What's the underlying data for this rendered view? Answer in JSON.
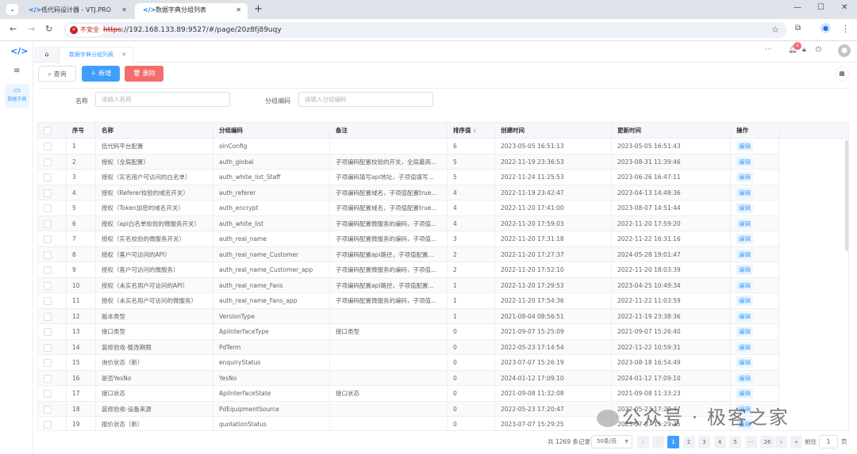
{
  "browser": {
    "tabs": [
      {
        "title": "低代码设计器 - VTJ.PRO",
        "active": false
      },
      {
        "title": "数据字典分组列表",
        "active": true
      }
    ],
    "insecure_label": "不安全",
    "url_scheme": "https",
    "url_rest": "://192.168.133.89:9527/#/page/20z8fj89uqy"
  },
  "sidebar": {
    "logo": "</>",
    "items": [
      {
        "label": "数据字典",
        "icon": "monitor-icon"
      }
    ]
  },
  "page_tabs": {
    "active": "数据字典分组列表"
  },
  "header": {
    "notification_count": "1"
  },
  "toolbar": {
    "query": "查询",
    "add": "新增",
    "delete": "删除"
  },
  "filters": [
    {
      "label": "名称",
      "placeholder": "请输入名称"
    },
    {
      "label": "分组编码",
      "placeholder": "请输入分组编码"
    }
  ],
  "table": {
    "columns": [
      "序号",
      "名称",
      "分组编码",
      "备注",
      "排序值",
      "创建时间",
      "更新时间",
      "操作"
    ],
    "action_label": "编辑",
    "rows": [
      [
        "1",
        "低代码平台配置",
        "oinConfig",
        "",
        "6",
        "2023-05-05 16:51:13",
        "2023-05-05 16:51:43"
      ],
      [
        "2",
        "授权（全局配置）",
        "auth_global",
        "子项编码配置校验的开关，全局最高...",
        "5",
        "2022-11-19 23:36:53",
        "2023-08-31 11:39:46"
      ],
      [
        "3",
        "授权（实名用户可访问的白名单）",
        "auth_white_list_Staff",
        "子项编码填写api地址，子项值填写...",
        "5",
        "2022-11-24 11:25:53",
        "2023-06-26 16:47:11"
      ],
      [
        "4",
        "授权（Referer校验的域名开关）",
        "auth_referer",
        "子项编码配置域名，子项值配置true...",
        "4",
        "2022-11-19 23:42:47",
        "2023-04-13 14:48:36"
      ],
      [
        "5",
        "授权（Token加密的域名开关）",
        "auth_encrypt",
        "子项编码配置域名，子项值配置true...",
        "4",
        "2022-11-20 17:41:00",
        "2023-08-07 14:51:44"
      ],
      [
        "6",
        "授权（api白名单校验的微服务开关）",
        "auth_white_list",
        "子项编码配置微服务的编码，子项值...",
        "4",
        "2022-11-20 17:59:03",
        "2022-11-20 17:59:20"
      ],
      [
        "7",
        "授权（实名校验的微服务开关）",
        "auth_real_name",
        "子项编码配置微服务的编码，子项值...",
        "3",
        "2022-11-20 17:31:18",
        "2022-11-22 16:31:16"
      ],
      [
        "8",
        "授权（客户可访问的API）",
        "auth_real_name_Customer",
        "子项编码配置api路径，子项值配置...",
        "2",
        "2022-11-20 17:27:37",
        "2024-05-28 19:01:47"
      ],
      [
        "9",
        "授权（客户可访问的微服务）",
        "auth_real_name_Customer_app",
        "子项编码配置微服务的编码，子项值...",
        "2",
        "2022-11-20 17:52:10",
        "2022-11-20 18:03:39"
      ],
      [
        "10",
        "授权（未实名用户可访问的API）",
        "auth_real_name_Fans",
        "子项编码配置api路径，子项值配置...",
        "1",
        "2022-11-20 17:29:53",
        "2023-04-25 10:49:34"
      ],
      [
        "11",
        "授权（未实名用户可访问的微服务）",
        "auth_real_name_Fans_app",
        "子项编码配置微服务的编码，子项值...",
        "1",
        "2022-11-20 17:54:36",
        "2022-11-22 11:03:59"
      ],
      [
        "12",
        "版本类型",
        "VersionType",
        "",
        "1",
        "2021-08-04 08:56:51",
        "2022-11-19 23:38:36"
      ],
      [
        "13",
        "接口类型",
        "ApiInterfaceType",
        "接口类型",
        "0",
        "2021-09-07 15:25:09",
        "2021-09-07 15:26:40"
      ],
      [
        "14",
        "装修验收-整改期限",
        "PdTerm",
        "",
        "0",
        "2022-05-23 17:14:54",
        "2022-11-22 10:59:31"
      ],
      [
        "15",
        "询价状态（新）",
        "enquiryStatus",
        "",
        "0",
        "2023-07-07 15:26:19",
        "2023-08-18 16:54:49"
      ],
      [
        "16",
        "是否YesNo",
        "YesNo",
        "",
        "0",
        "2024-01-12 17:09:10",
        "2024-01-12 17:09:10"
      ],
      [
        "17",
        "接口状态",
        "ApiInterfaceState",
        "接口状态",
        "0",
        "2021-09-08 11:32:08",
        "2021-09-08 11:33:23"
      ],
      [
        "18",
        "装修验收-设备来源",
        "PdEquipmentSource",
        "",
        "0",
        "2022-05-23 17:20:47",
        "2022-05-23 17:20:47"
      ],
      [
        "19",
        "报价状态（新）",
        "quotationStatus",
        "",
        "0",
        "2023-07-07 15:29:25",
        "2023-07-07 15:29:35"
      ]
    ]
  },
  "pagination": {
    "total": "共 1269 条记录",
    "page_size": "50条/页",
    "pages": [
      "1",
      "2",
      "3",
      "4",
      "5",
      "···",
      "26"
    ],
    "current": "1",
    "goto_label": "前往",
    "goto_value": "1",
    "page_suffix": "页"
  },
  "watermark": "公众号 · 极客之家",
  "colors": {
    "primary": "#409eff",
    "danger": "#f56c6c"
  }
}
